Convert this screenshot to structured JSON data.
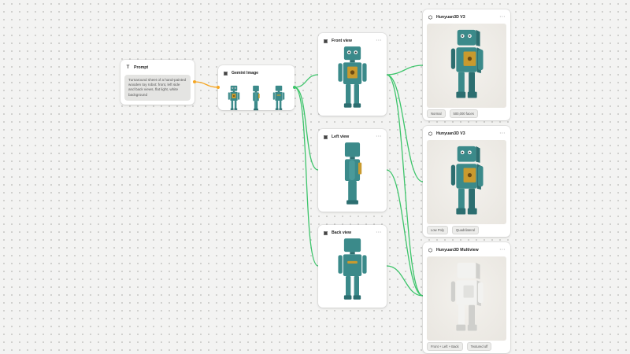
{
  "colors": {
    "wire_green": "#3cc46a",
    "wire_orange": "#f5a623",
    "robot_teal": "#3b8a8a",
    "robot_panel": "#c99a2e",
    "clay": "#f2f2f0"
  },
  "prompt_node": {
    "title": "Prompt",
    "icon": "text-icon",
    "text": "Turnaround sheet of a hand-painted wooden toy robot: front, left side and back views, flat light, white background"
  },
  "gemini_node": {
    "title": "Gemini Image",
    "icon": "image-icon"
  },
  "view_nodes": [
    {
      "title": "Front view",
      "icon": "image-icon"
    },
    {
      "title": "Left view",
      "icon": "image-icon"
    },
    {
      "title": "Back view",
      "icon": "image-icon"
    }
  ],
  "output_nodes": [
    {
      "title": "Hunyuan3D V3",
      "icon": "cube-icon",
      "tags": [
        "Normal",
        "500,000 faces"
      ]
    },
    {
      "title": "Hunyuan3D V3",
      "icon": "cube-icon",
      "tags": [
        "Low Poly",
        "Quadrilateral"
      ]
    },
    {
      "title": "Hunyuan3D Multiview",
      "icon": "cube-icon",
      "tags": [
        "Front + Left + Back",
        "Textured off"
      ]
    }
  ]
}
